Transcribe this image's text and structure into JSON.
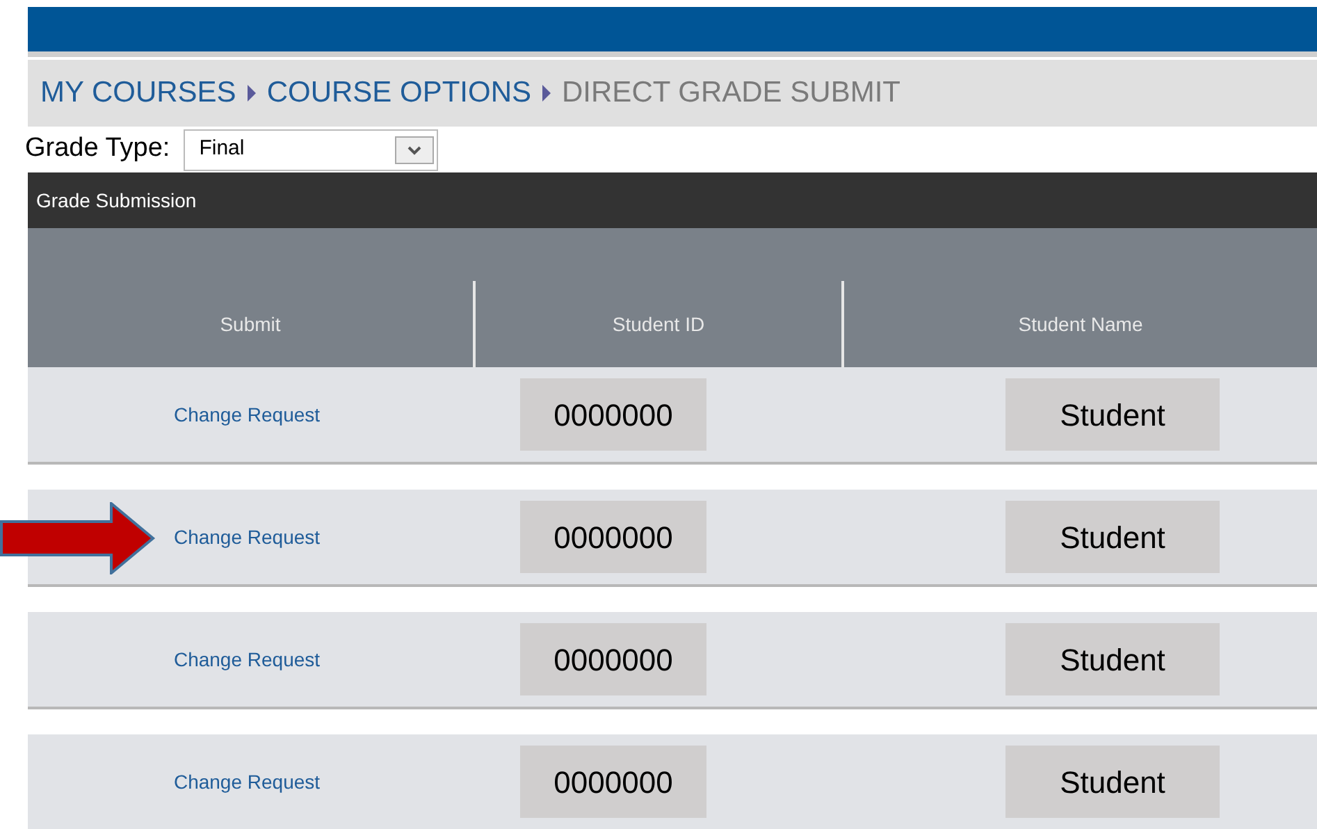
{
  "breadcrumb": [
    {
      "label": "MY COURSES",
      "selected": false
    },
    {
      "label": "COURSE OPTIONS",
      "selected": false
    },
    {
      "label": "DIRECT GRADE SUBMIT",
      "selected": true
    }
  ],
  "grade_type": {
    "label": "Grade Type:",
    "value": "Final"
  },
  "panel": {
    "title": "Grade Submission"
  },
  "table": {
    "columns": [
      "Submit",
      "Student ID",
      "Student Name"
    ],
    "rows": [
      {
        "submit": "Change Request",
        "student_id": "0000000",
        "student_name": "Student",
        "arrow": false
      },
      {
        "submit": "Change Request",
        "student_id": "0000000",
        "student_name": "Student",
        "arrow": true
      },
      {
        "submit": "Change Request",
        "student_id": "0000000",
        "student_name": "Student",
        "arrow": false
      },
      {
        "submit": "Change Request",
        "student_id": "0000000",
        "student_name": "Student",
        "arrow": false
      }
    ]
  }
}
